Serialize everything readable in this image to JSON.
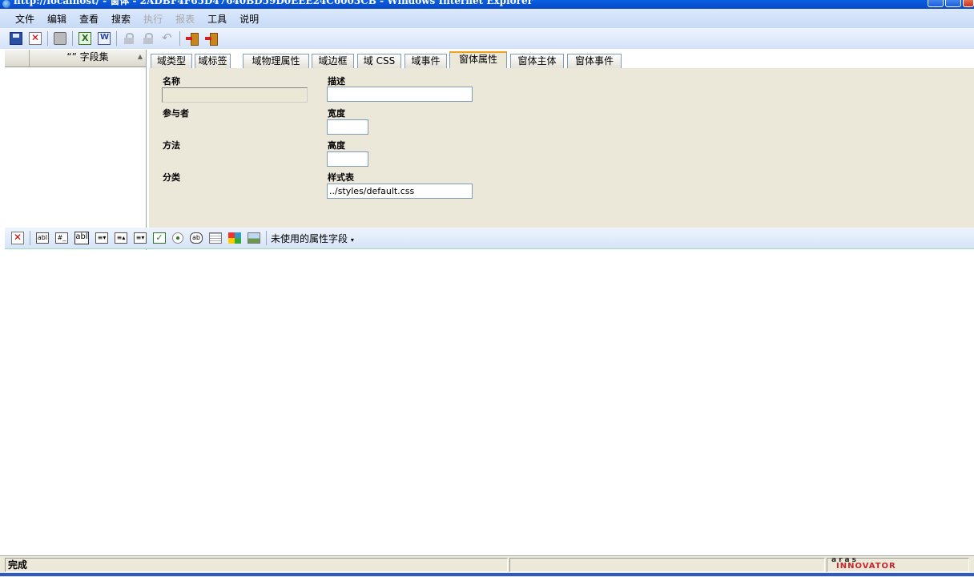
{
  "window": {
    "title": "http://localhost/ - 窗体 - 2ADBF4F65D47640BD59D0EEE24C6003CB - Windows Internet Explorer"
  },
  "menu": [
    "文件",
    "编辑",
    "查看",
    "搜索",
    "执行",
    "报表",
    "工具",
    "说明"
  ],
  "menu_disabled": [
    "执行",
    "报表"
  ],
  "toolbar_icons": [
    "save-icon",
    "delete-icon",
    "print-icon",
    "excel-icon",
    "word-icon",
    "lock-icon",
    "unlock-icon",
    "undo-icon",
    "claim-icon",
    "exit-icon"
  ],
  "left_panel": {
    "column_header": "“” 字段集"
  },
  "tabs": [
    "域类型",
    "域标签",
    "域物理属性",
    "域边框",
    "域 CSS",
    "域事件",
    "窗体属性",
    "窗体主体",
    "窗体事件"
  ],
  "active_tab": "窗体属性",
  "form_properties": {
    "name_label": "名称",
    "name_value": "",
    "participants_label": "参与者",
    "method_label": "方法",
    "category_label": "分类",
    "description_label": "描述",
    "description_value": "",
    "width_label": "宽度",
    "width_value": "",
    "height_label": "高度",
    "height_value": "",
    "stylesheet_label": "样式表",
    "stylesheet_value": "../styles/default.css"
  },
  "field_toolbar": {
    "unused_fields_label": "未使用的属性字段",
    "field_type_icons": [
      "text",
      "integer",
      "textarea",
      "dropdown",
      "listbox",
      "multi-listbox",
      "checkbox",
      "radio",
      "button",
      "grid",
      "color-picker",
      "image"
    ]
  },
  "status": {
    "text": "完成",
    "logo_top": "aras",
    "logo_bottom": "INNOVATOR"
  }
}
